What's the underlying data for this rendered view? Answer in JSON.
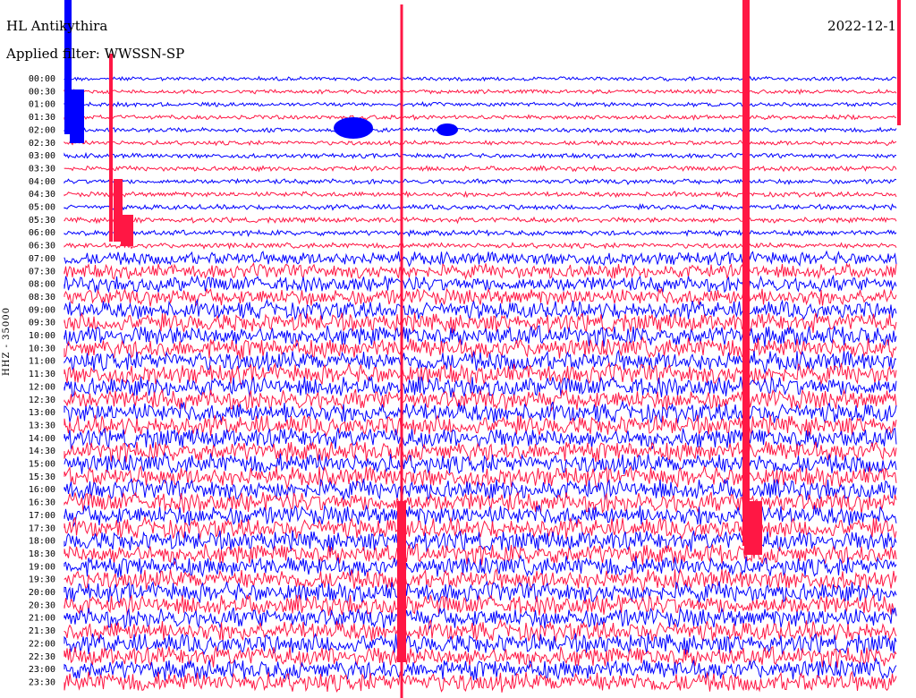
{
  "header": {
    "station": "HL Antikythira",
    "filter_label": "Applied filter: WWSSN-SP",
    "date": "2022-12-1"
  },
  "axis": {
    "channel_label": "HHZ - 35000"
  },
  "colors": {
    "trace_a": "#0000ff",
    "trace_b": "#ff1744",
    "background": "#ffffff"
  },
  "chart_data": {
    "type": "line",
    "title": "HL Antikythira",
    "subtitle": "Applied filter: WWSSN-SP",
    "ylabel": "HHZ - 35000",
    "row_labels": [
      "00:00",
      "00:30",
      "01:00",
      "01:30",
      "02:00",
      "02:30",
      "03:00",
      "03:30",
      "04:00",
      "04:30",
      "05:00",
      "05:30",
      "06:00",
      "06:30",
      "07:00",
      "07:30",
      "08:00",
      "08:30",
      "09:00",
      "09:30",
      "10:00",
      "10:30",
      "11:00",
      "11:30",
      "12:00",
      "12:30",
      "13:00",
      "13:30",
      "14:00",
      "14:30",
      "15:00",
      "15:30",
      "16:00",
      "16:30",
      "17:00",
      "17:30",
      "18:00",
      "18:30",
      "19:00",
      "19:30",
      "20:00",
      "20:30",
      "21:00",
      "21:30",
      "22:00",
      "22:30",
      "23:00",
      "23:30"
    ],
    "row_colors": [
      "blue",
      "red"
    ],
    "grid": false
  }
}
